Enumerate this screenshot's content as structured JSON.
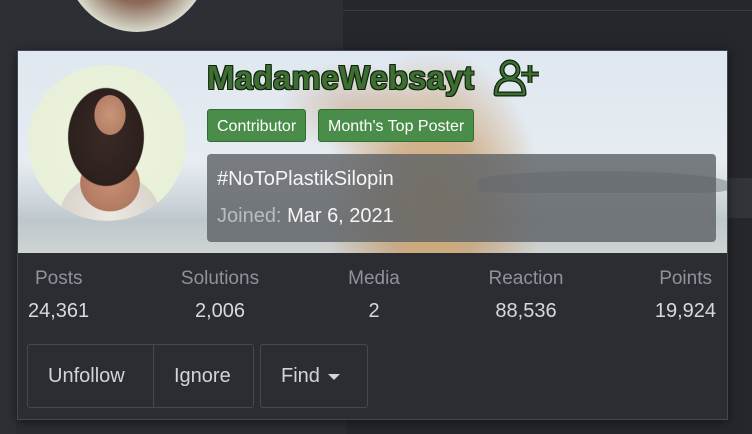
{
  "profile": {
    "username": "MadameWebsayt",
    "follow_icon": "user-plus-icon",
    "badges": [
      "Contributor",
      "Month's Top Poster"
    ],
    "status": "#NoToPlastikSilopin",
    "joined_label": "Joined:",
    "joined_value": "Mar 6, 2021"
  },
  "stats": [
    {
      "label": "Posts",
      "value": "24,361"
    },
    {
      "label": "Solutions",
      "value": "2,006"
    },
    {
      "label": "Media",
      "value": "2"
    },
    {
      "label": "Reaction",
      "value": "88,536"
    },
    {
      "label": "Points",
      "value": "19,924"
    }
  ],
  "actions": {
    "unfollow": "Unfollow",
    "ignore": "Ignore",
    "find": "Find",
    "find_icon": "caret-down-icon"
  },
  "colors": {
    "badge_bg": "#4a8d4a",
    "username": "#3d6f33",
    "card_bg": "#2c2d33"
  }
}
